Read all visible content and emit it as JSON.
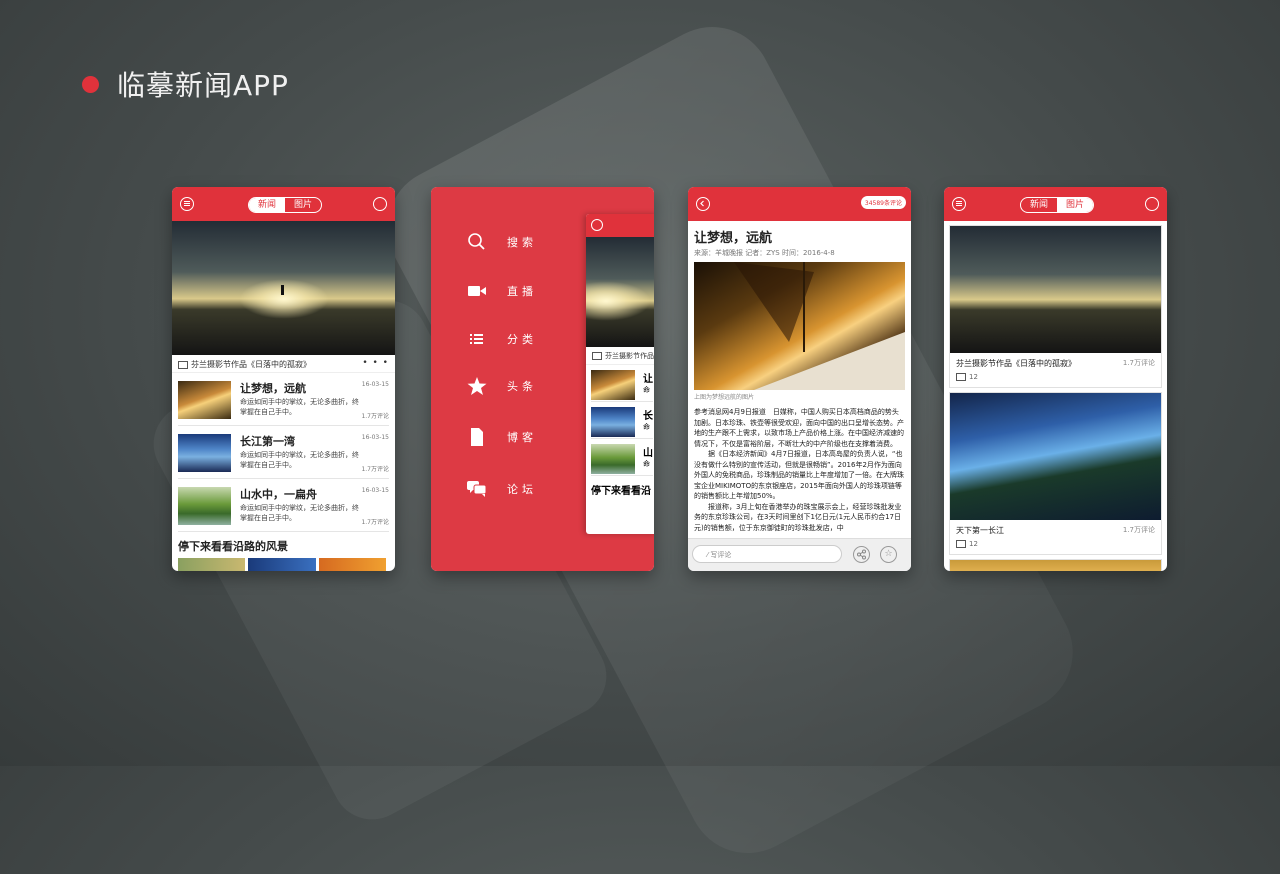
{
  "page": {
    "title": "临摹新闻APP"
  },
  "colors": {
    "accent": "#e0323b",
    "menu_bg": "#dd3a44"
  },
  "home": {
    "tabs": [
      "新闻",
      "图片"
    ],
    "active_tab": "新闻",
    "hero_caption": "芬兰摄影节作品《日落中的孤寂》",
    "more": "• • •",
    "news": [
      {
        "title": "让梦想，远航",
        "date": "16-03-15",
        "desc": "命运如同手中的掌纹，无论多曲折，终掌握在自己手中。",
        "comments": "1.7万评论"
      },
      {
        "title": "长江第一湾",
        "date": "16-03-15",
        "desc": "命运如同手中的掌纹，无论多曲折，终掌握在自己手中。",
        "comments": "1.7万评论"
      },
      {
        "title": "山水中，一扁舟",
        "date": "16-03-15",
        "desc": "命运如同手中的掌纹，无论多曲折，终掌握在自己手中。",
        "comments": "1.7万评论"
      }
    ],
    "section_title": "停下来看看沿路的风景"
  },
  "menu": {
    "items": [
      {
        "label": "搜索",
        "icon": "search-icon"
      },
      {
        "label": "直播",
        "icon": "video-camera-icon"
      },
      {
        "label": "分类",
        "icon": "list-icon"
      },
      {
        "label": "头条",
        "icon": "star-icon"
      },
      {
        "label": "博客",
        "icon": "document-icon"
      },
      {
        "label": "论坛",
        "icon": "chat-bubbles-icon"
      }
    ],
    "mini_caption": "芬兰摄影节作品",
    "mini_titles": [
      "让",
      "长",
      "山"
    ],
    "mini_desc": "命",
    "mini_section": "停下来看看沿"
  },
  "detail": {
    "comment_badge": "34589条评论",
    "title": "让梦想，远航",
    "meta": "来源：羊城晚报  记者：ZYS  时间：2016-4-8",
    "image_caption": "上图为梦想远航的图片",
    "paragraphs": [
      "参考消息网4月9日报道　日媒称，中国人购买日本高档商品的势头加剧。日本珍珠、铁壶等很受欢迎，面向中国的出口呈增长态势。产地的生产跟不上需求，以致市场上产品价格上涨。在中国经济减速的情况下，不仅是富裕阶层，不断壮大的中产阶级也在支撑着消费。",
      "据《日本经济新闻》4月7日报道，日本高岛屋的负责人说，“也没有做什么特别的宣传活动，但就是很畅销”。2016年2月作为面向外国人的免税商品，珍珠制品的销量比上年度增加了一倍。在大牌珠宝企业MIKIMOTO的东京银座店，2015年面向外国人的珍珠项链等的销售额比上年增加50%。",
      "报道称，3月上旬在香港举办的珠宝展示会上，经营珍珠批发业务的东京珍珠公司，在3天时间里创下1亿日元(1元人民币约合17日元)的销售额，位于东京御徒町的珍珠批发店，中"
    ],
    "comment_placeholder": "写评论"
  },
  "pictures": {
    "tabs": [
      "新闻",
      "图片"
    ],
    "active_tab": "图片",
    "items": [
      {
        "title": "芬兰摄影节作品《日落中的孤寂》",
        "comments": "1.7万评论",
        "count": "12"
      },
      {
        "title": "天下第一长江",
        "comments": "1.7万评论",
        "count": "12"
      }
    ]
  }
}
